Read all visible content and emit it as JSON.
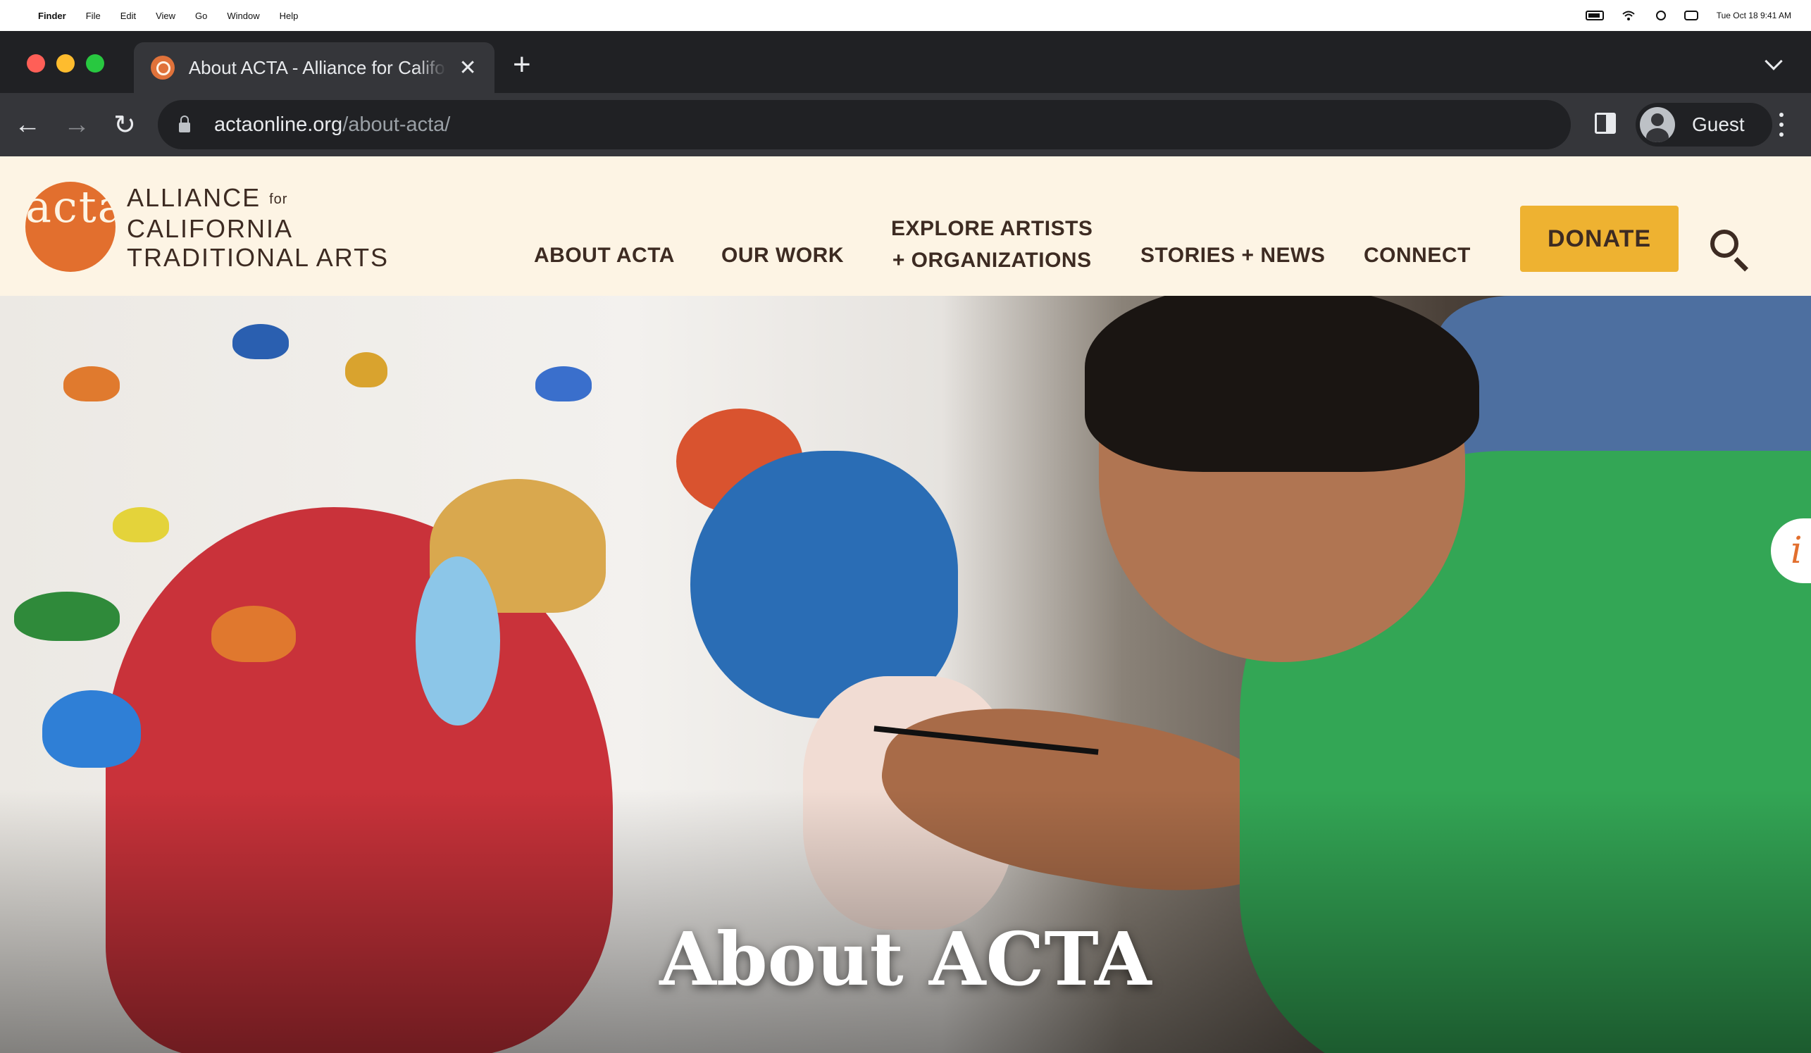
{
  "menubar": {
    "app_name": "Finder",
    "items": [
      "File",
      "Edit",
      "View",
      "Go",
      "Window",
      "Help"
    ],
    "datetime": "Tue Oct 18  9:41 AM"
  },
  "browser": {
    "tab_title": "About ACTA - Alliance for California Traditional Arts",
    "url_host": "actaonline.org",
    "url_path": "/about-acta/",
    "profile_name": "Guest"
  },
  "site": {
    "logo_mark": "acta",
    "logo_line1": "ALLIANCE",
    "logo_for": "for",
    "logo_line2": "CALIFORNIA",
    "logo_line3": "TRADITIONAL ARTS",
    "nav": {
      "about": "ABOUT ACTA",
      "work": "OUR WORK",
      "explore_line1": "EXPLORE ARTISTS",
      "explore_line2": "+ ORGANIZATIONS",
      "stories": "STORIES + NEWS",
      "connect": "CONNECT"
    },
    "donate_label": "DONATE",
    "hero_title": "About ACTA",
    "info_label": "i"
  },
  "colors": {
    "brand_orange": "#e26f2e",
    "donate_gold": "#eeb231",
    "header_bg": "#fdf4e4",
    "text_brown": "#3d2b22"
  }
}
